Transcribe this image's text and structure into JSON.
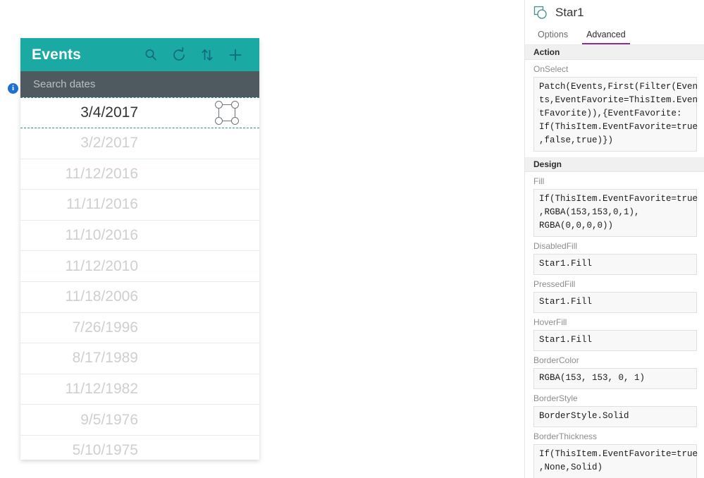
{
  "canvas": {
    "info_icon": "info-icon",
    "info_glyph": "i"
  },
  "gallery": {
    "title": "Events",
    "header_icons": [
      {
        "name": "search-icon",
        "label": "Search"
      },
      {
        "name": "refresh-icon",
        "label": "Refresh"
      },
      {
        "name": "sort-icon",
        "label": "Sort"
      },
      {
        "name": "add-icon",
        "label": "Add"
      }
    ],
    "search": {
      "placeholder": "Search dates",
      "value": ""
    },
    "rows": [
      {
        "date": "3/4/2017",
        "selected": true
      },
      {
        "date": "3/2/2017",
        "selected": false
      },
      {
        "date": "11/12/2016",
        "selected": false
      },
      {
        "date": "11/11/2016",
        "selected": false
      },
      {
        "date": "11/10/2016",
        "selected": false
      },
      {
        "date": "11/12/2010",
        "selected": false
      },
      {
        "date": "11/18/2006",
        "selected": false
      },
      {
        "date": "7/26/1996",
        "selected": false
      },
      {
        "date": "8/17/1989",
        "selected": false
      },
      {
        "date": "11/12/1982",
        "selected": false
      },
      {
        "date": "9/5/1976",
        "selected": false
      },
      {
        "date": "5/10/1975",
        "selected": false
      }
    ]
  },
  "panel": {
    "control_icon": "shape-control-icon",
    "control_name": "Star1",
    "tabs": [
      {
        "label": "Options",
        "active": false
      },
      {
        "label": "Advanced",
        "active": true
      }
    ],
    "sections": [
      {
        "title": "Action",
        "properties": [
          {
            "label": "OnSelect",
            "value": "Patch(Events,First(Filter(Even\nts,EventFavorite=ThisItem.Even\ntFavorite)),{EventFavorite:\nIf(ThisItem.EventFavorite=true\n,false,true)})"
          }
        ]
      },
      {
        "title": "Design",
        "properties": [
          {
            "label": "Fill",
            "value": "If(ThisItem.EventFavorite=true\n,RGBA(153,153,0,1),\nRGBA(0,0,0,0))"
          },
          {
            "label": "DisabledFill",
            "value": "Star1.Fill"
          },
          {
            "label": "PressedFill",
            "value": "Star1.Fill"
          },
          {
            "label": "HoverFill",
            "value": "Star1.Fill"
          },
          {
            "label": "BorderColor",
            "value": "RGBA(153, 153, 0, 1)"
          },
          {
            "label": "BorderStyle",
            "value": "BorderStyle.Solid"
          },
          {
            "label": "BorderThickness",
            "value": "If(ThisItem.EventFavorite=true\n,None,Solid)"
          }
        ]
      }
    ],
    "accent_color": "#8a2f8d",
    "gallery_header_color": "#1aa9a3"
  }
}
